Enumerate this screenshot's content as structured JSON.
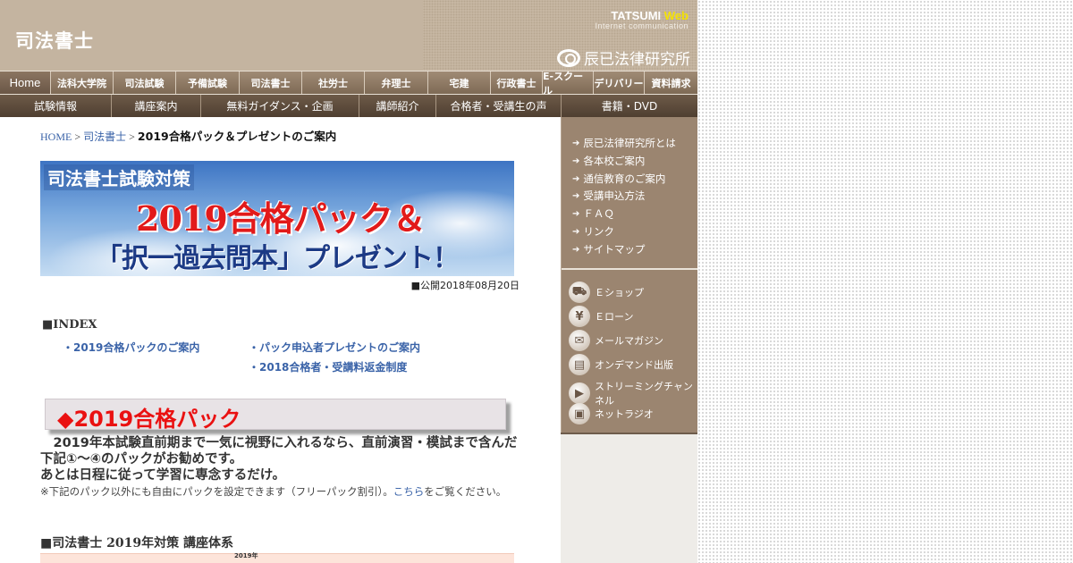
{
  "header": {
    "site_title": "司法書士",
    "brand_line1": "TATSUMI",
    "brand_line1_accent": "Web",
    "brand_line2": "Internet communication",
    "org_name": "辰已法律研究所"
  },
  "nav_primary": [
    {
      "label": "Home"
    },
    {
      "label": "法科大学院"
    },
    {
      "label": "司法試験"
    },
    {
      "label": "予備試験"
    },
    {
      "label": "司法書士"
    },
    {
      "label": "社労士"
    },
    {
      "label": "弁理士"
    },
    {
      "label": "宅建"
    },
    {
      "label": "行政書士"
    },
    {
      "label": "E-スクール"
    },
    {
      "label": "デリバリー"
    },
    {
      "label": "資料請求"
    }
  ],
  "nav_secondary": [
    {
      "label": "試験情報"
    },
    {
      "label": "講座案内"
    },
    {
      "label": "無料ガイダンス・企画"
    },
    {
      "label": "講師紹介"
    },
    {
      "label": "合格者・受講生の声"
    },
    {
      "label": "書籍・DVD"
    }
  ],
  "breadcrumb": {
    "home": "HOME",
    "sep": ">",
    "parent": "司法書士",
    "current": "2019合格パック＆プレゼントのご案内"
  },
  "banner": {
    "top_text": "司法書士試験対策",
    "main_text": "2019合格パック＆",
    "sub_text": "「択一過去問本」プレゼント！"
  },
  "published": "■公開2018年08月20日",
  "index": {
    "title": "■INDEX",
    "links": [
      "・2019合格パックのご案内",
      "・パック申込者プレゼントのご案内",
      "・2018合格者・受講料返金制度"
    ]
  },
  "section": {
    "heading": "◆2019合格パック",
    "body_line1": "　2019年本試験直前期まで一気に視野に入れるなら、直前演習・模試まで含んだ下記①～④のパックがお勧めです。",
    "body_line2": "あとは日程に従って学習に専念するだけ。",
    "note_prefix": "※下記のパック以外にも自由にパックを設定できます（フリーパック割引）。",
    "note_link": "こちら",
    "note_suffix": "をご覧ください。",
    "system_title": "■司法書士 2019年対策 講座体系",
    "table_year": "2019年"
  },
  "sidebar": {
    "links": [
      "辰已法律研究所とは",
      "各本校ご案内",
      "通信教育のご案内",
      "受講申込方法",
      "ＦＡＱ",
      "リンク",
      "サイトマップ"
    ],
    "services": [
      {
        "label": "Ｅショップ",
        "icon": "cart-icon"
      },
      {
        "label": "Ｅローン",
        "icon": "yen-icon"
      },
      {
        "label": "メールマガジン",
        "icon": "mail-icon"
      },
      {
        "label": "オンデマンド出版",
        "icon": "book-icon"
      },
      {
        "label": "ストリーミングチャンネル",
        "icon": "video-camera-icon"
      },
      {
        "label": "ネットラジオ",
        "icon": "radio-icon"
      }
    ]
  }
}
